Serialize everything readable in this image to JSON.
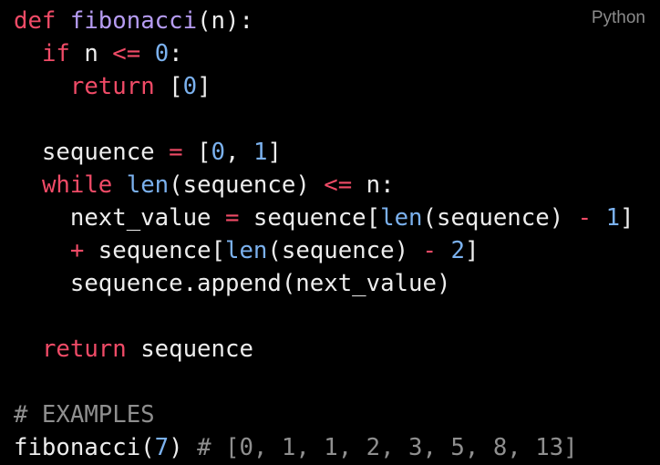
{
  "language_label": "Python",
  "colors": {
    "background": "#000000",
    "keyword": "#f04b67",
    "function_name": "#b69cf2",
    "number": "#7bb1ee",
    "builtin": "#7bb1ee",
    "comment": "#8f8f8f",
    "text": "#ededed",
    "language_label": "#8b8b8b"
  },
  "code_lines": [
    [
      {
        "t": "def",
        "k": "kw"
      },
      {
        "t": " ",
        "k": "tx"
      },
      {
        "t": "fibonacci",
        "k": "fn"
      },
      {
        "t": "(n):",
        "k": "tx"
      }
    ],
    [
      {
        "t": "  ",
        "k": "tx"
      },
      {
        "t": "if",
        "k": "kw"
      },
      {
        "t": " n ",
        "k": "tx"
      },
      {
        "t": "<=",
        "k": "kw"
      },
      {
        "t": " ",
        "k": "tx"
      },
      {
        "t": "0",
        "k": "num"
      },
      {
        "t": ":",
        "k": "tx"
      }
    ],
    [
      {
        "t": "    ",
        "k": "tx"
      },
      {
        "t": "return",
        "k": "kw"
      },
      {
        "t": " [",
        "k": "tx"
      },
      {
        "t": "0",
        "k": "num"
      },
      {
        "t": "]",
        "k": "tx"
      }
    ],
    [],
    [
      {
        "t": "  sequence ",
        "k": "tx"
      },
      {
        "t": "=",
        "k": "kw"
      },
      {
        "t": " [",
        "k": "tx"
      },
      {
        "t": "0",
        "k": "num"
      },
      {
        "t": ", ",
        "k": "tx"
      },
      {
        "t": "1",
        "k": "num"
      },
      {
        "t": "]",
        "k": "tx"
      }
    ],
    [
      {
        "t": "  ",
        "k": "tx"
      },
      {
        "t": "while",
        "k": "kw"
      },
      {
        "t": " ",
        "k": "tx"
      },
      {
        "t": "len",
        "k": "bi"
      },
      {
        "t": "(sequence) ",
        "k": "tx"
      },
      {
        "t": "<=",
        "k": "kw"
      },
      {
        "t": " n:",
        "k": "tx"
      }
    ],
    [
      {
        "t": "    next_value ",
        "k": "tx"
      },
      {
        "t": "=",
        "k": "kw"
      },
      {
        "t": " sequence[",
        "k": "tx"
      },
      {
        "t": "len",
        "k": "bi"
      },
      {
        "t": "(sequence) ",
        "k": "tx"
      },
      {
        "t": "-",
        "k": "kw"
      },
      {
        "t": " ",
        "k": "tx"
      },
      {
        "t": "1",
        "k": "num"
      },
      {
        "t": "]",
        "k": "tx"
      }
    ],
    [
      {
        "t": "    ",
        "k": "tx"
      },
      {
        "t": "+",
        "k": "kw"
      },
      {
        "t": " sequence[",
        "k": "tx"
      },
      {
        "t": "len",
        "k": "bi"
      },
      {
        "t": "(sequence) ",
        "k": "tx"
      },
      {
        "t": "-",
        "k": "kw"
      },
      {
        "t": " ",
        "k": "tx"
      },
      {
        "t": "2",
        "k": "num"
      },
      {
        "t": "]",
        "k": "tx"
      }
    ],
    [
      {
        "t": "    sequence.append(next_value)",
        "k": "tx"
      }
    ],
    [],
    [
      {
        "t": "  ",
        "k": "tx"
      },
      {
        "t": "return",
        "k": "kw"
      },
      {
        "t": " sequence",
        "k": "tx"
      }
    ],
    [],
    [
      {
        "t": "# EXAMPLES",
        "k": "cm"
      }
    ],
    [
      {
        "t": "fibonacci(",
        "k": "tx"
      },
      {
        "t": "7",
        "k": "num"
      },
      {
        "t": ") ",
        "k": "tx"
      },
      {
        "t": "# [0, 1, 1, 2, 3, 5, 8, 13]",
        "k": "cm"
      }
    ]
  ]
}
